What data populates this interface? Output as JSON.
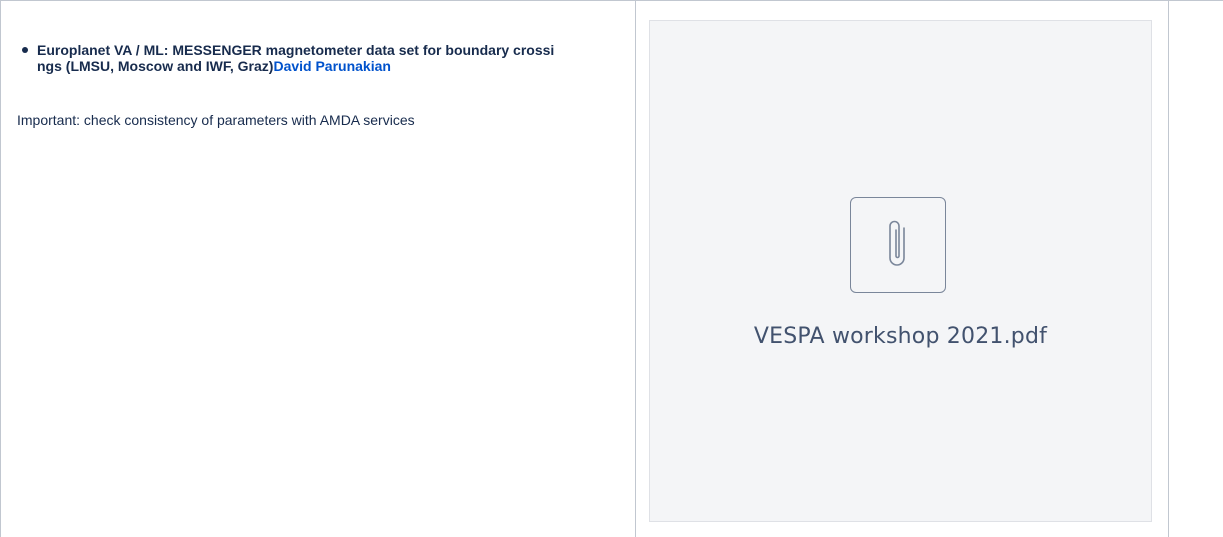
{
  "content": {
    "item_title": "Europlanet VA / ML: MESSENGER magnetometer data set for boundary crossings (LMSU, Moscow and IWF, Graz)",
    "item_user": "David Parunakian",
    "note": "Important: check consistency of parameters with AMDA services"
  },
  "attachment": {
    "icon": "paperclip-icon",
    "file_name": "VESPA workshop 2021.pdf"
  },
  "colors": {
    "text": "#172b4d",
    "link": "#0052cc",
    "border": "#c1c7d0",
    "attachment_bg": "#f4f5f7"
  }
}
